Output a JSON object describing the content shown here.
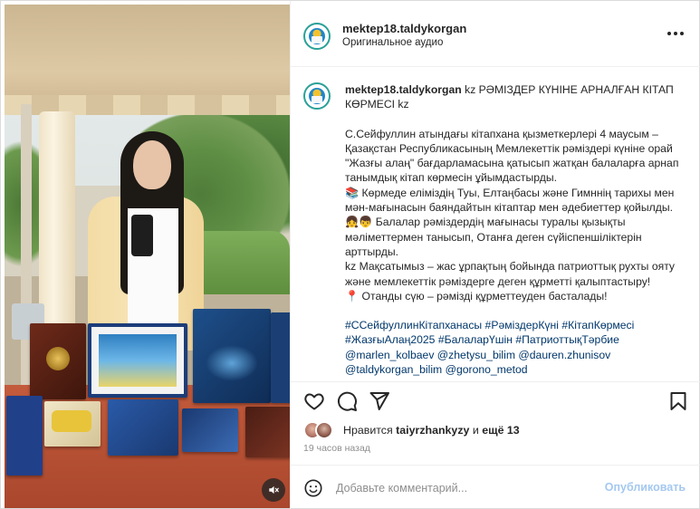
{
  "post": {
    "username": "mektep18.taldykorgan",
    "audio": "Оригинальное аудио"
  },
  "caption": {
    "username": "mektep18.taldykorgan",
    "headline": "kz РӘМІЗДЕР КҮНІНЕ АРНАЛҒАН КІТАП КӨРМЕСІ kz",
    "paragraph1": "С.Сейфуллин атындағы кітапхана қызметкерлері 4 маусым – Қазақстан Республикасының Мемлекеттік рәміздері күніне орай \"Жазғы алаң\" бағдарламасына қатысып жатқан балаларға арнап танымдық кітап көрмесін ұйымдастырды.",
    "line_books": "📚 Көрмеде еліміздің Туы, Елтаңбасы және Гимннің тарихы мен мән-мағынасын баяндайтын кітаптар мен әдебиеттер қойылды.",
    "line_children": "👧👦 Балалар рәміздердің мағынасы туралы қызықты мәліметтермен танысып, Отанға деген сүйіспеншіліктерін арттырды.",
    "line_goal": "kz Мақсатымыз – жас ұрпақтың бойында патриоттық рухты ояту және мемлекеттік рәміздерге деген құрметті қалыптастыру!",
    "line_pin": "📍 Отанды сүю – рәмізді құрметтеуден басталады!",
    "hashtags_line1": "#ССейфуллинКітапханасы #РәміздерКүні #КітапКөрмесі",
    "hashtags_line2": "#ЖазғыАлаң2025 #БалаларҮшін #ПатриоттықТәрбие",
    "mentions_line1": "@marlen_kolbaev @zhetysu_bilim @dauren.zhunisov",
    "mentions_line2": "@taldykorgan_bilim @gorono_metod"
  },
  "likes": {
    "prefix": "Нравится",
    "user": "taiyrzhankyzy",
    "middle": "и",
    "more": "ещё 13"
  },
  "time_ago": "19 часов назад",
  "comment": {
    "placeholder": "Добавьте комментарий...",
    "publish_label": "Опубликовать"
  },
  "icons": {
    "like": "heart-icon",
    "comment": "comment-icon",
    "share": "send-icon",
    "save": "bookmark-icon",
    "more": "more-icon",
    "emoji": "emoji-icon",
    "mute": "muted-speaker-icon"
  },
  "colors": {
    "link": "#00376b",
    "muted_text": "#8e8e8e",
    "publish_disabled": "#a4c8f0"
  }
}
